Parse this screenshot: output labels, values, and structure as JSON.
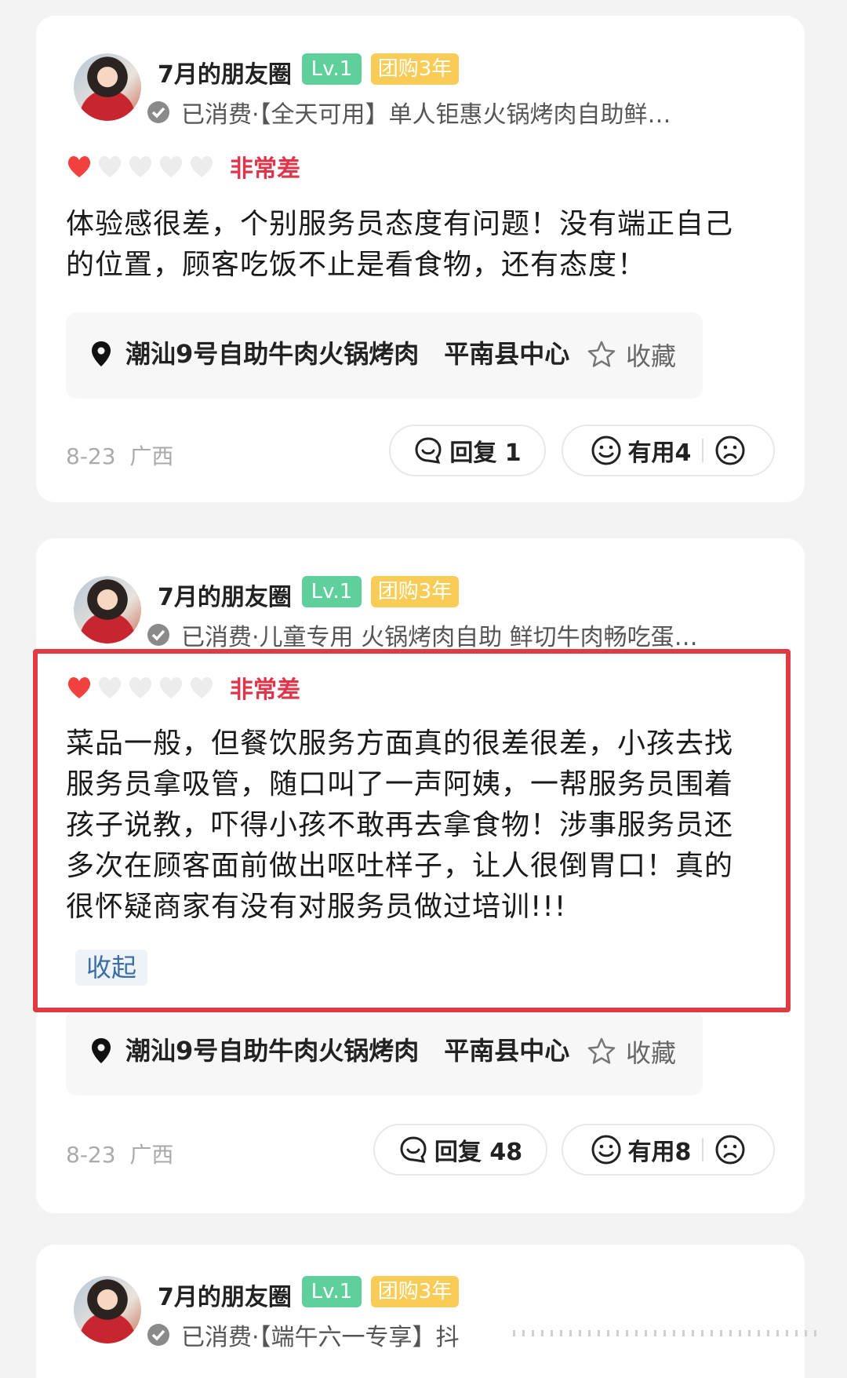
{
  "reviews": [
    {
      "user": {
        "name": "7月的朋友圈",
        "level": "Lv.1",
        "tag": "团购3年"
      },
      "consumed": "已消费·【全天可用】单人钜惠火锅烤肉自助鲜…",
      "rating": {
        "hearts_filled": 1,
        "hearts_total": 5,
        "label": "非常差"
      },
      "text": "体验感很差，个别服务员态度有问题！没有端正自己的位置，顾客吃饭不止是看食物，还有态度！",
      "shop": {
        "name": "潮汕9号自助牛肉火锅烤肉　平南县中心",
        "fav_label": "收藏"
      },
      "date": "8-23",
      "region": "广西",
      "reply_label": "回复 1",
      "useful_label": "有用4"
    },
    {
      "user": {
        "name": "7月的朋友圈",
        "level": "Lv.1",
        "tag": "团购3年"
      },
      "consumed": "已消费·儿童专用 火锅烤肉自助 鲜切牛肉畅吃蛋…",
      "rating": {
        "hearts_filled": 1,
        "hearts_total": 5,
        "label": "非常差"
      },
      "text": "菜品一般，但餐饮服务方面真的很差很差，小孩去找服务员拿吸管，随口叫了一声阿姨，一帮服务员围着孩子说教，吓得小孩不敢再去拿食物！涉事服务员还多次在顾客面前做出呕吐样子，让人很倒胃口！真的很怀疑商家有没有对服务员做过培训!!!",
      "collapse_label": "收起",
      "shop": {
        "name": "潮汕9号自助牛肉火锅烤肉　平南县中心",
        "fav_label": "收藏"
      },
      "date": "8-23",
      "region": "广西",
      "reply_label": "回复 48",
      "useful_label": "有用8"
    },
    {
      "user": {
        "name": "7月的朋友圈",
        "level": "Lv.1",
        "tag": "团购3年"
      },
      "consumed": "已消费·【端午六一专享】抖"
    }
  ],
  "colors": {
    "accent_red": "#e0344a",
    "highlight_border": "#de3b44",
    "level_green": "#5fcf9c",
    "tag_yellow": "#f8cc56"
  },
  "icons": [
    "verified-icon",
    "heart-icon",
    "location-pin-icon",
    "star-icon",
    "reply-bubble-icon",
    "smile-icon",
    "frown-icon"
  ]
}
